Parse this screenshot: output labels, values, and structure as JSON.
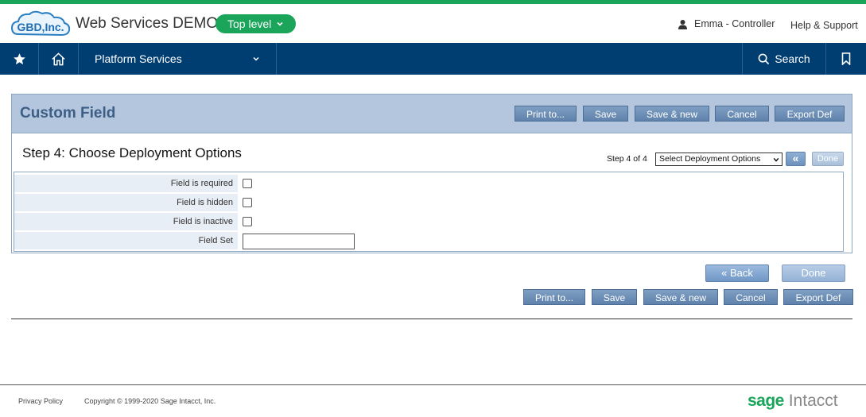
{
  "header": {
    "logo_text": "GBD,Inc.",
    "app_title": "Web Services DEMO",
    "level_label": "Top level",
    "user_label": "Emma - Controller",
    "help_label": "Help & Support"
  },
  "nav": {
    "platform_label": "Platform Services",
    "search_label": "Search"
  },
  "panel": {
    "title": "Custom Field",
    "toolbar": {
      "print_label": "Print to...",
      "save_label": "Save",
      "save_new_label": "Save & new",
      "cancel_label": "Cancel",
      "export_label": "Export Def"
    }
  },
  "step": {
    "title": "Step 4: Choose Deployment Options",
    "counter": "Step 4 of 4",
    "select_value": "Select Deployment Options",
    "prev_label": "«",
    "done_label": "Done"
  },
  "form": {
    "fields": [
      {
        "label": "Field is required",
        "type": "checkbox",
        "checked": false
      },
      {
        "label": "Field is hidden",
        "type": "checkbox",
        "checked": false
      },
      {
        "label": "Field is inactive",
        "type": "checkbox",
        "checked": false
      },
      {
        "label": "Field Set",
        "type": "text",
        "value": ""
      }
    ]
  },
  "bottom": {
    "back_label": "« Back",
    "done_label": "Done",
    "toolbar": {
      "print_label": "Print to...",
      "save_label": "Save",
      "save_new_label": "Save & new",
      "cancel_label": "Cancel",
      "export_label": "Export Def"
    }
  },
  "footer": {
    "privacy_label": "Privacy Policy",
    "copyright": "Copyright © 1999-2020 Sage Intacct, Inc.",
    "brand_sage": "sage",
    "brand_intacct": "Intacct"
  },
  "colors": {
    "accent_green": "#1aa55a",
    "nav_blue": "#003e72",
    "panel_blue": "#b3c6de",
    "button_blue": "#5f82ac"
  }
}
